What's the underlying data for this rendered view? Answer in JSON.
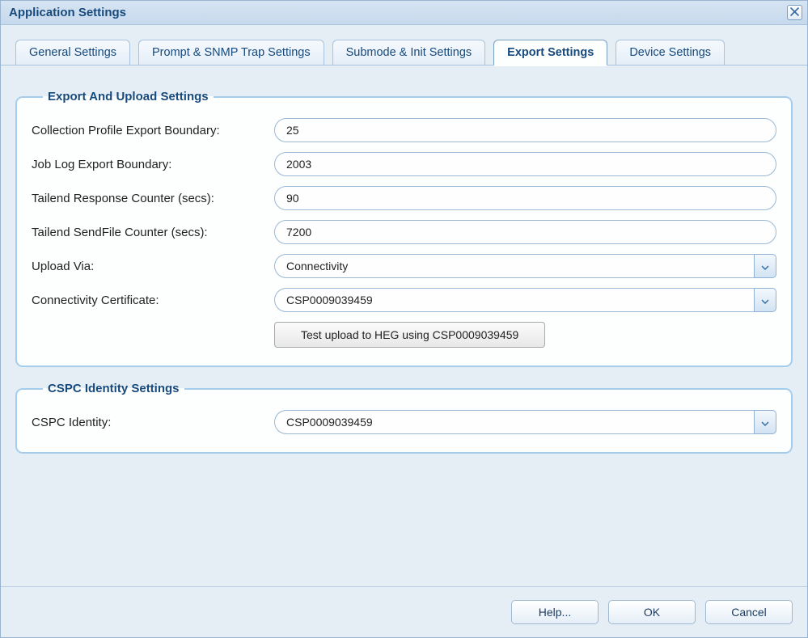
{
  "window": {
    "title": "Application Settings"
  },
  "tabs": [
    {
      "label": "General Settings",
      "active": false
    },
    {
      "label": "Prompt & SNMP Trap Settings",
      "active": false
    },
    {
      "label": "Submode & Init Settings",
      "active": false
    },
    {
      "label": "Export Settings",
      "active": true
    },
    {
      "label": "Device Settings",
      "active": false
    }
  ],
  "export_group": {
    "legend": "Export And Upload Settings",
    "fields": {
      "collection_profile_label": "Collection Profile Export Boundary:",
      "collection_profile_value": "25",
      "job_log_label": "Job Log Export Boundary:",
      "job_log_value": "2003",
      "tailend_response_label": "Tailend Response Counter (secs):",
      "tailend_response_value": "90",
      "tailend_sendfile_label": "Tailend SendFile Counter (secs):",
      "tailend_sendfile_value": "7200",
      "upload_via_label": "Upload Via:",
      "upload_via_value": "Connectivity",
      "conn_cert_label": "Connectivity Certificate:",
      "conn_cert_value": "CSP0009039459",
      "test_button": "Test upload to HEG using CSP0009039459"
    }
  },
  "identity_group": {
    "legend": "CSPC Identity Settings",
    "identity_label": "CSPC Identity:",
    "identity_value": "CSP0009039459"
  },
  "buttons": {
    "help": "Help...",
    "ok": "OK",
    "cancel": "Cancel"
  }
}
